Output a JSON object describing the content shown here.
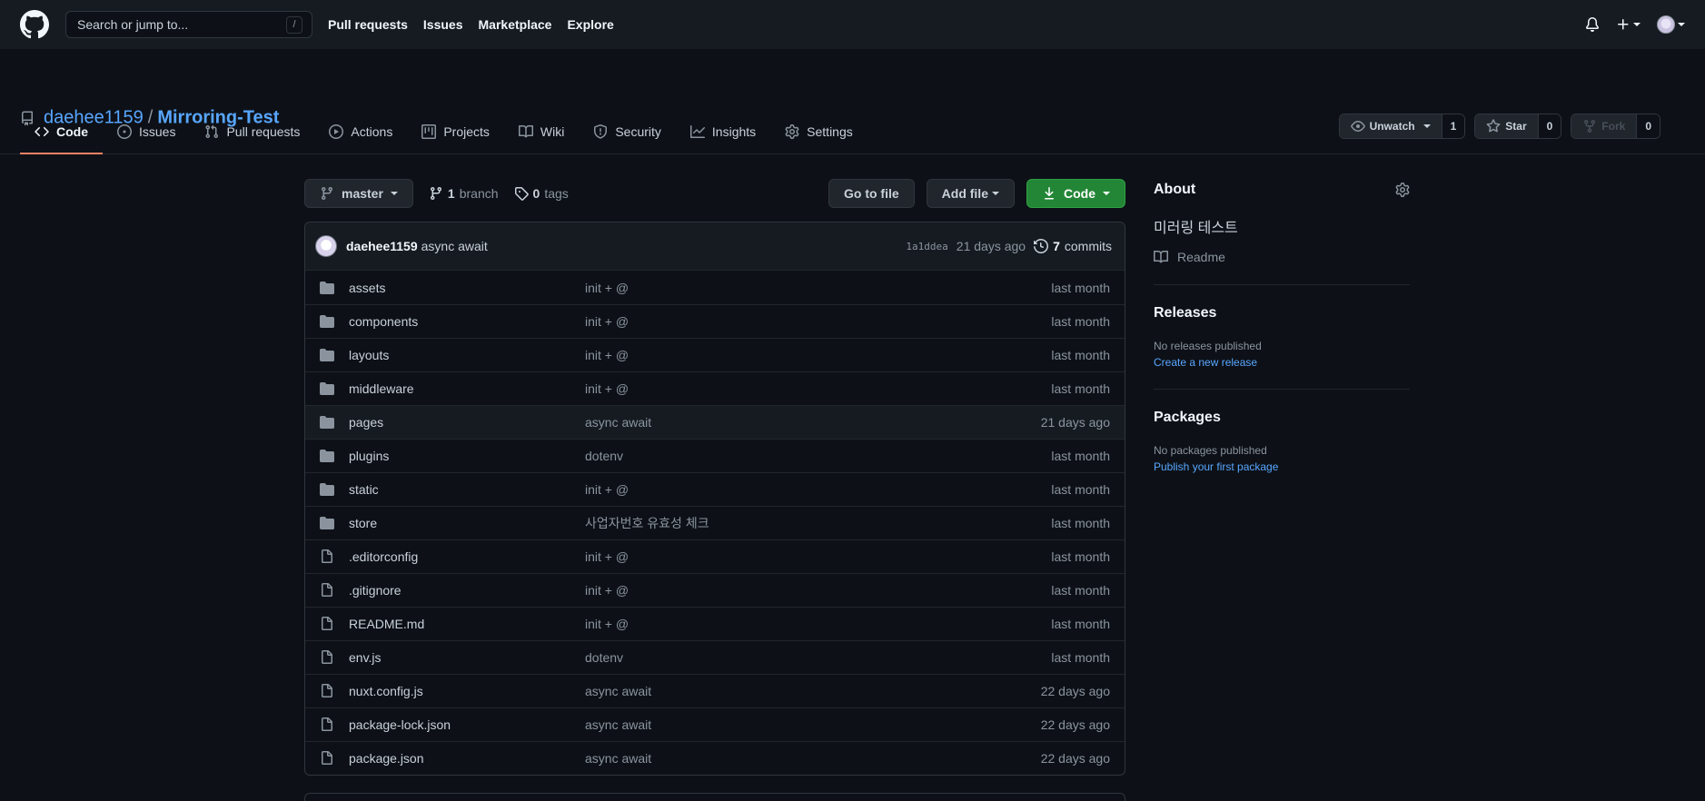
{
  "header": {
    "search_placeholder": "Search or jump to...",
    "search_key": "/",
    "nav": [
      "Pull requests",
      "Issues",
      "Marketplace",
      "Explore"
    ]
  },
  "repo": {
    "owner": "daehee1159",
    "separator": "/",
    "name": "Mirroring-Test",
    "watch_label": "Unwatch",
    "watch_count": "1",
    "star_label": "Star",
    "star_count": "0",
    "fork_label": "Fork",
    "fork_count": "0"
  },
  "tabs": [
    "Code",
    "Issues",
    "Pull requests",
    "Actions",
    "Projects",
    "Wiki",
    "Security",
    "Insights",
    "Settings"
  ],
  "file_nav": {
    "branch": "master",
    "branch_count": "1",
    "branch_label": "branch",
    "tag_count": "0",
    "tag_label": "tags",
    "go_to_file": "Go to file",
    "add_file": "Add file",
    "code": "Code"
  },
  "latest_commit": {
    "author": "daehee1159",
    "message": "async await",
    "sha": "1a1ddea",
    "age": "21 days ago",
    "commit_count": "7",
    "commit_label": "commits"
  },
  "files": [
    {
      "type": "dir",
      "name": "assets",
      "message": "init + @",
      "age": "last month"
    },
    {
      "type": "dir",
      "name": "components",
      "message": "init + @",
      "age": "last month"
    },
    {
      "type": "dir",
      "name": "layouts",
      "message": "init + @",
      "age": "last month"
    },
    {
      "type": "dir",
      "name": "middleware",
      "message": "init + @",
      "age": "last month"
    },
    {
      "type": "dir",
      "name": "pages",
      "message": "async await",
      "age": "21 days ago"
    },
    {
      "type": "dir",
      "name": "plugins",
      "message": "dotenv",
      "age": "last month"
    },
    {
      "type": "dir",
      "name": "static",
      "message": "init + @",
      "age": "last month"
    },
    {
      "type": "dir",
      "name": "store",
      "message": "사업자번호 유효성 체크",
      "age": "last month"
    },
    {
      "type": "file",
      "name": ".editorconfig",
      "message": "init + @",
      "age": "last month"
    },
    {
      "type": "file",
      "name": ".gitignore",
      "message": "init + @",
      "age": "last month"
    },
    {
      "type": "file",
      "name": "README.md",
      "message": "init + @",
      "age": "last month"
    },
    {
      "type": "file",
      "name": "env.js",
      "message": "dotenv",
      "age": "last month"
    },
    {
      "type": "file",
      "name": "nuxt.config.js",
      "message": "async await",
      "age": "22 days ago"
    },
    {
      "type": "file",
      "name": "package-lock.json",
      "message": "async await",
      "age": "22 days ago"
    },
    {
      "type": "file",
      "name": "package.json",
      "message": "async await",
      "age": "22 days ago"
    }
  ],
  "sidebar": {
    "about_title": "About",
    "description": "미러링 테스트",
    "readme": "Readme",
    "releases_title": "Releases",
    "releases_empty": "No releases published",
    "releases_link": "Create a new release",
    "packages_title": "Packages",
    "packages_empty": "No packages published",
    "packages_link": "Publish your first package"
  },
  "colors": {
    "background": "#0d1117",
    "header": "#161b22",
    "link": "#58a6ff",
    "primary_button": "#238636",
    "tab_underline": "#f78166"
  }
}
